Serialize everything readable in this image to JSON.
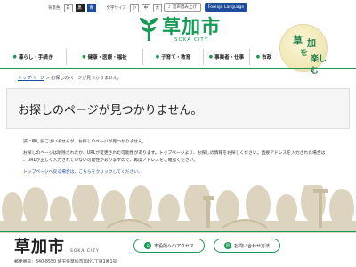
{
  "utility": {
    "bg_label": "背景色",
    "bg_white": "白",
    "bg_black": "黒",
    "bg_blue": "青",
    "font_label": "文字サイズ",
    "font_small": "小",
    "font_medium": "中",
    "font_large": "大",
    "voice_label": "音声読み上げ",
    "lang_label": "Foreign Language"
  },
  "logo": {
    "main": "草加市",
    "sub": "SOKA CITY",
    "color": "#159a55"
  },
  "emblem": {
    "chars": [
      "草",
      "加",
      "を",
      "楽しむ"
    ]
  },
  "nav": {
    "items": [
      {
        "label": "暮らし・手続き"
      },
      {
        "label": "健康・医療・福祉"
      },
      {
        "label": "子育て・教育"
      },
      {
        "label": "事業者・仕事"
      },
      {
        "label": "市政"
      }
    ]
  },
  "breadcrumb": {
    "home": "トップページ",
    "sep": " > ",
    "current": "お探しのページが見つかりません。"
  },
  "heading": "お探しのページが見つかりません。",
  "body": {
    "p1": "誠に申し訳ございませんが、お探しのページが見つかりません。",
    "p2a": "お探しのページは削除されたか、URLが変更された可能性があります。トップページより、お探しの情報をお探しください。直接アドレスを入力された場合は",
    "p2b": "、URLが正しく入力されていない可能性がありますので、再度アドレスをご確認ください。",
    "link": "トップページへ戻る場合は、こちらをクリックしてください。"
  },
  "footer": {
    "logo_main": "草加市",
    "logo_sub": "SOKA CITY",
    "access_label": "市役所へのアクセス",
    "contact_label": "お問い合わせ方法",
    "address": "郵便番号：340-8550 埼玉県草加市高砂1丁目1番1号"
  },
  "colors": {
    "accent": "#1a9a55",
    "link": "#1e4c9a"
  }
}
